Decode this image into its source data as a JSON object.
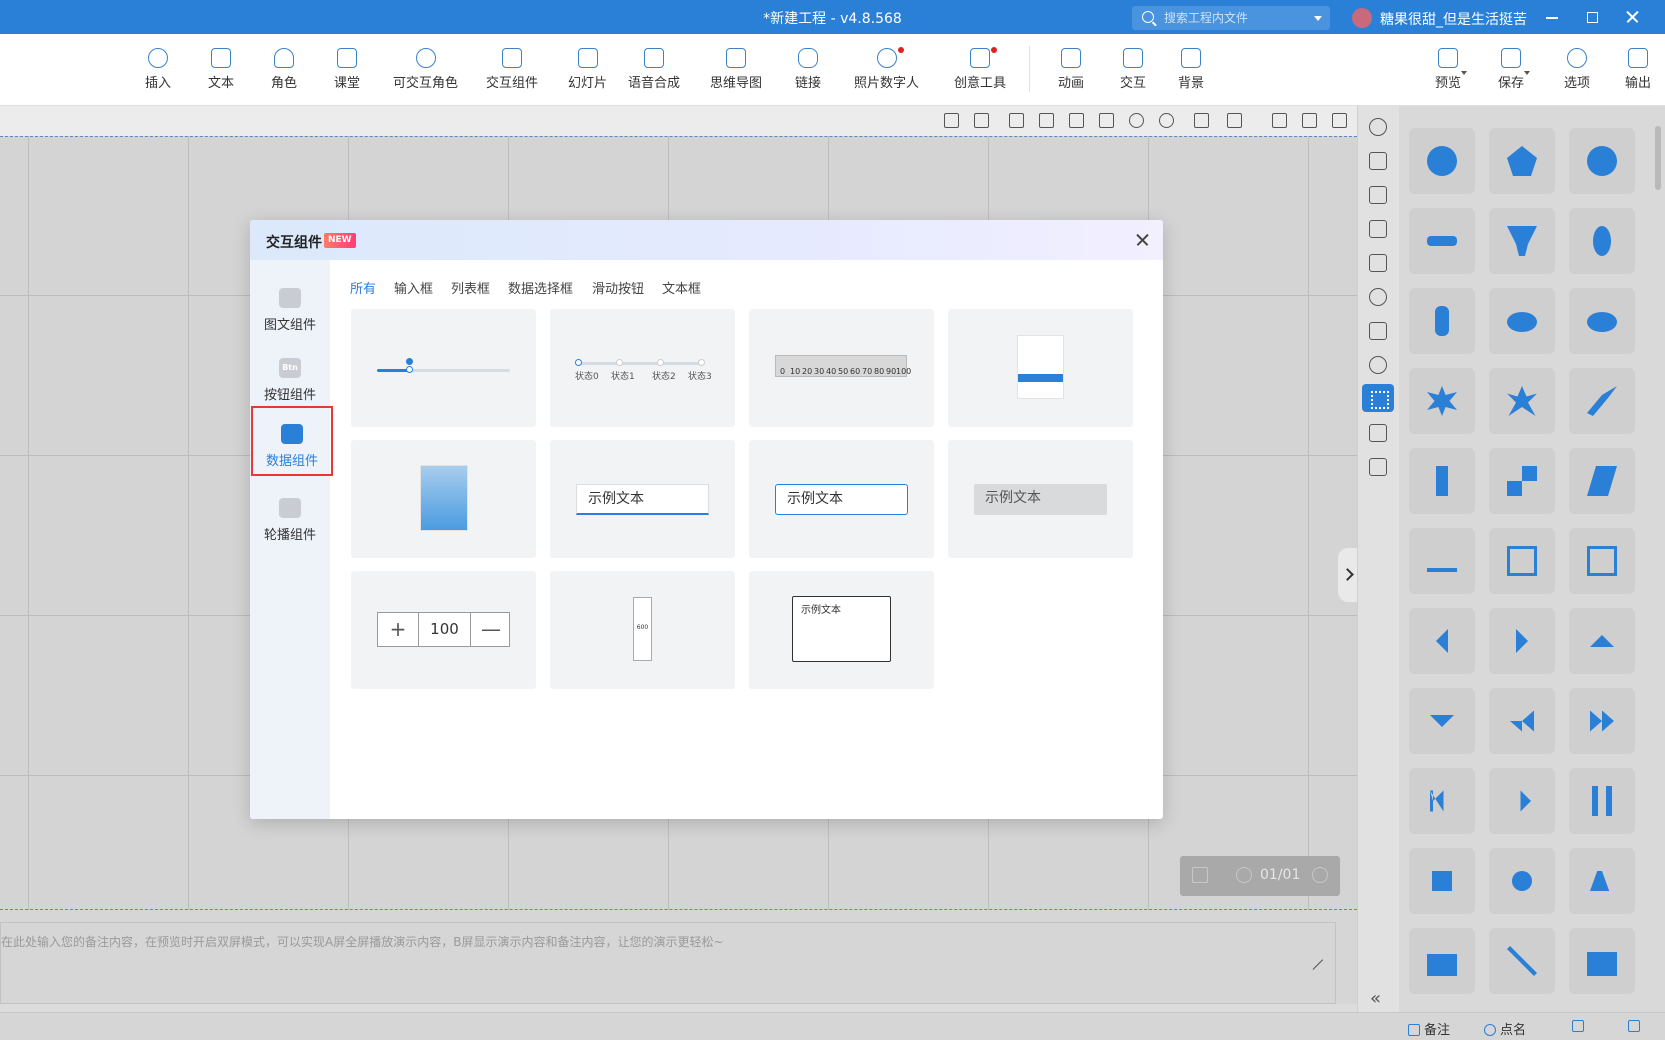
{
  "window": {
    "title": "*新建工程 - v4.8.568",
    "search_placeholder": "搜索工程内文件",
    "username": "糖果很甜_但是生活挺苦"
  },
  "toolbar": {
    "items": [
      {
        "label": "插入",
        "icon": "plus-circle-icon"
      },
      {
        "label": "文本",
        "icon": "text-icon"
      },
      {
        "label": "角色",
        "icon": "person-icon"
      },
      {
        "label": "课堂",
        "icon": "classroom-icon"
      },
      {
        "label": "可交互角色",
        "icon": "interactive-person-icon"
      },
      {
        "label": "交互组件",
        "icon": "pointer-icon"
      },
      {
        "label": "幻灯片",
        "icon": "slides-icon"
      },
      {
        "label": "语音合成",
        "icon": "waveform-icon"
      },
      {
        "label": "思维导图",
        "icon": "mindmap-icon"
      },
      {
        "label": "链接",
        "icon": "link-icon"
      },
      {
        "label": "照片数字人",
        "icon": "digital-human-icon"
      },
      {
        "label": "创意工具",
        "icon": "creative-tools-icon"
      },
      {
        "label": "动画",
        "icon": "star-anim-icon"
      },
      {
        "label": "交互",
        "icon": "hand-icon"
      },
      {
        "label": "背景",
        "icon": "background-icon"
      },
      {
        "label": "预览",
        "icon": "preview-icon"
      },
      {
        "label": "保存",
        "icon": "save-icon"
      },
      {
        "label": "选项",
        "icon": "options-icon"
      },
      {
        "label": "输出",
        "icon": "export-icon"
      }
    ]
  },
  "canvas": {
    "page_indicator": "01/01",
    "notes_placeholder": "在此处输入您的备注内容，在预览时开启双屏模式，可以实现A屏全屏播放演示内容，B屏显示演示内容和备注内容，让您的演示更轻松~"
  },
  "statusbar": {
    "notes_label": "备注",
    "rollcall_label": "点名"
  },
  "dialog": {
    "title": "交互组件",
    "badge": "NEW",
    "categories": [
      {
        "label": "图文组件",
        "icon": "image-icon",
        "icon_text": ""
      },
      {
        "label": "按钮组件",
        "icon": "button-icon",
        "icon_text": "Btn"
      },
      {
        "label": "数据组件",
        "icon": "data-layers-icon",
        "icon_text": ""
      },
      {
        "label": "轮播组件",
        "icon": "carousel-icon",
        "icon_text": ""
      }
    ],
    "active_category": "数据组件",
    "tabs": [
      "所有",
      "输入框",
      "列表框",
      "数据选择框",
      "滑动按钮",
      "文本框"
    ],
    "active_tab": "所有",
    "cards": {
      "state_labels": [
        "状态0",
        "状态1",
        "状态2",
        "状态3"
      ],
      "ruler_labels": [
        "0",
        "10",
        "20",
        "30",
        "40",
        "50",
        "60",
        "70",
        "80",
        "90",
        "100"
      ],
      "slider_fill_fraction": 0.25,
      "sample_text": "示例文本",
      "stepper_value": "100",
      "stepper_plus": "+",
      "stepper_minus": "—",
      "spinner_value": "600",
      "textbox_text": "示例文本"
    }
  },
  "colors": {
    "accent": "#2a7fd6",
    "highlight_border": "#e53935",
    "badge": "#ff3d7a"
  }
}
